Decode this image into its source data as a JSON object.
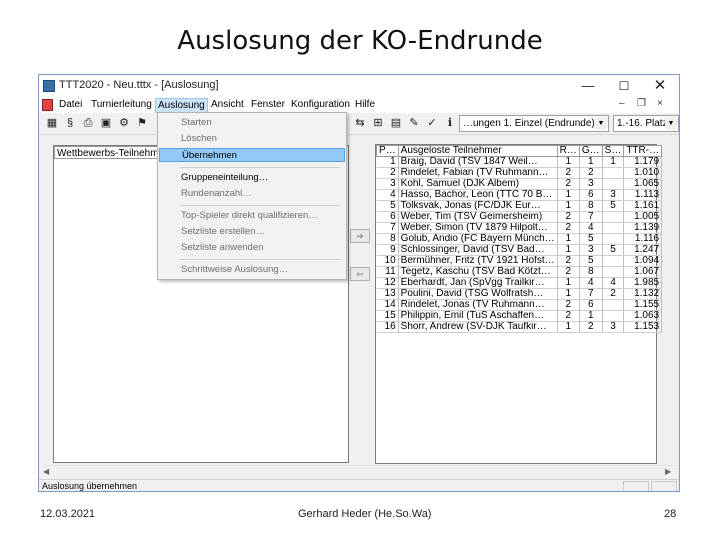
{
  "slide": {
    "title": "Auslosung der KO-Endrunde",
    "footer_date": "12.03.2021",
    "footer_author": "Gerhard Heder (He.So.Wa)",
    "footer_page": "28"
  },
  "window": {
    "title": "TTT2020 - Neu.tttx - [Auslosung]",
    "controls": {
      "minimize": "—",
      "maximize": "☐",
      "close": "✕"
    },
    "mdi_controls": {
      "minimize": "–",
      "restore": "❐",
      "close": "×"
    }
  },
  "menu": [
    "Datei",
    "Turnierleitung",
    "Auslosung",
    "Ansicht",
    "Fenster",
    "Konfiguration",
    "Hilfe"
  ],
  "toolbar": {
    "competition_combo": "Einzel (Endrunde)",
    "competition_combo_prefix": "…ungen 1. ",
    "places_combo": "1.-16. Platz",
    "arrow": "▼"
  },
  "dropdown": {
    "items": [
      {
        "label": "Starten",
        "enabled": false
      },
      {
        "label": "Löschen",
        "enabled": false
      },
      {
        "label": "Übernehmen",
        "enabled": true,
        "highlighted": true
      },
      {
        "label": "Gruppeneinteilung…",
        "enabled": true
      },
      {
        "label": "Rundenanzahl…",
        "enabled": false
      },
      {
        "label": "Top-Spieler direkt qualifizieren…",
        "enabled": false
      },
      {
        "label": "Setzliste erstellen…",
        "enabled": false
      },
      {
        "label": "Setzliste anwenden",
        "enabled": false
      },
      {
        "label": "Schrittweise Auslosung…",
        "enabled": false
      }
    ]
  },
  "left_list": {
    "header": "Wettbewerbs-Teilnehmer"
  },
  "arrow_buttons": {
    "add": "➔",
    "remove": "⇐"
  },
  "grid": {
    "columns": [
      "P…",
      "Ausgeloste Teilnehmer",
      "R…",
      "G…",
      "S…",
      "TTR-…"
    ],
    "rows": [
      [
        "1",
        "Braig, David (TSV 1847 Weil…",
        "1",
        "1",
        "1",
        "1.179"
      ],
      [
        "2",
        "Rindelet, Fabian (TV Ruhmann…",
        "2",
        "2",
        "",
        "1.010"
      ],
      [
        "3",
        "Kohl, Samuel (DJK Albem)",
        "2",
        "3",
        "",
        "1.065"
      ],
      [
        "4",
        "Hasso, Bachor, Leon (TTC 70 B…",
        "1",
        "6",
        "3",
        "1.113"
      ],
      [
        "5",
        "Tolksvak, Jonas (FC/DJK Eur…",
        "1",
        "8",
        "5",
        "1.161"
      ],
      [
        "6",
        "Weber, Tim (TSV Geimersheim)",
        "2",
        "7",
        "",
        "1.005"
      ],
      [
        "7",
        "Weber, Simon (TV 1879 Hilpolt…",
        "2",
        "4",
        "",
        "1.139"
      ],
      [
        "8",
        "Golub, Andio (FC Bayern Münch…",
        "1",
        "5",
        "",
        "1.116"
      ],
      [
        "9",
        "Schlossinger, David (TSV Bad…",
        "1",
        "3",
        "5",
        "1.247"
      ],
      [
        "10",
        "Bermühner, Fritz (TV 1921 Hofst…",
        "2",
        "5",
        "",
        "1.094"
      ],
      [
        "11",
        "Tegetz, Kaschu (TSV Bad Kötzt…",
        "2",
        "8",
        "",
        "1.067"
      ],
      [
        "12",
        "Eberhardt, Jan (SpVgg Trailkir…",
        "1",
        "4",
        "4",
        "1.985"
      ],
      [
        "13",
        "Poulini, David (TSG Wolfratsh…",
        "1",
        "7",
        "2",
        "1.132"
      ],
      [
        "14",
        "Rindelet, Jonas (TV Ruhmann…",
        "2",
        "6",
        "",
        "1.155"
      ],
      [
        "15",
        "Philippin, Emil (TuS Aschaffen…",
        "2",
        "1",
        "",
        "1.063"
      ],
      [
        "16",
        "Shorr, Andrew (SV-DJK Taufkir…",
        "1",
        "2",
        "3",
        "1.153"
      ]
    ]
  },
  "status": "Auslosung übernehmen"
}
